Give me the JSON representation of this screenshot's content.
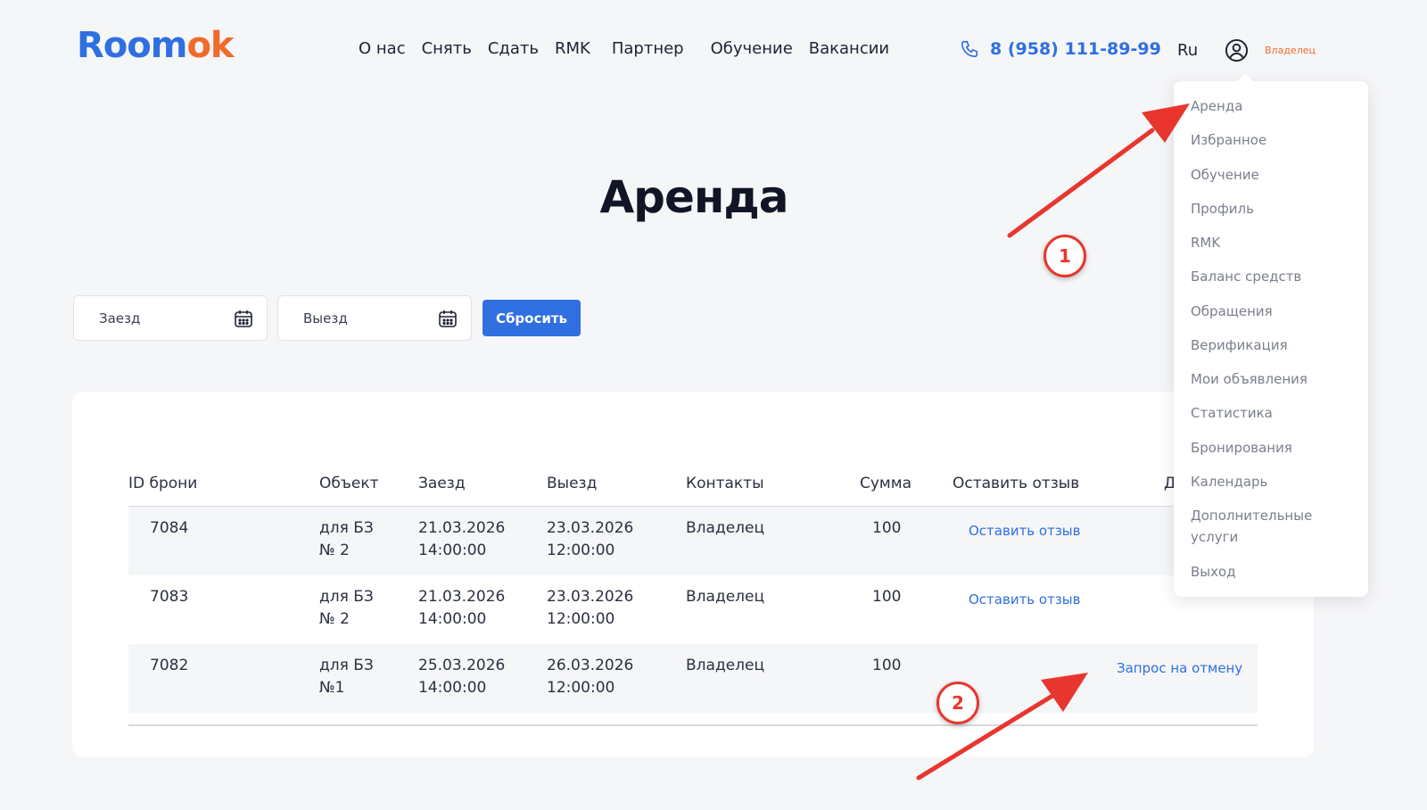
{
  "brand": {
    "logo_part1": "Room",
    "logo_part2": "ok"
  },
  "nav": [
    "О нас",
    "Снять",
    "Сдать",
    "RMK",
    "Партнер",
    "Обучение",
    "Вакансии"
  ],
  "header": {
    "phone": "8 (958) 111-89-99",
    "lang": "Ru",
    "role": "Владелец"
  },
  "page_title": "Аренда",
  "filters": {
    "checkin_placeholder": "Заезд",
    "checkout_placeholder": "Выезд",
    "reset_label": "Сбросить"
  },
  "table": {
    "headers": [
      "ID брони",
      "Объект",
      "Заезд",
      "Выезд",
      "Контакты",
      "Сумма",
      "Оставить отзыв",
      "Д"
    ],
    "rows": [
      {
        "id": "7084",
        "object": "для БЗ № 2",
        "checkin": "21.03.2026 14:00:00",
        "checkout": "23.03.2026 12:00:00",
        "contacts": "Владелец",
        "sum": "100",
        "review": "Оставить отзыв",
        "action": ""
      },
      {
        "id": "7083",
        "object": "для БЗ № 2",
        "checkin": "21.03.2026 14:00:00",
        "checkout": "23.03.2026 12:00:00",
        "contacts": "Владелец",
        "sum": "100",
        "review": "Оставить отзыв",
        "action": ""
      },
      {
        "id": "7082",
        "object": "для БЗ №1",
        "checkin": "25.03.2026 14:00:00",
        "checkout": "26.03.2026 12:00:00",
        "contacts": "Владелец",
        "sum": "100",
        "review": "",
        "action": "Запрос на отмену"
      }
    ]
  },
  "dropdown": [
    "Аренда",
    "Избранное",
    "Обучение",
    "Профиль",
    "RMK",
    "Баланс средств",
    "Обращения",
    "Верификация",
    "Мои объявления",
    "Статистика",
    "Бронирования",
    "Календарь",
    "Дополнительные услуги",
    "Выход"
  ],
  "annotations": {
    "badge1": "1",
    "badge2": "2"
  },
  "colors": {
    "accent": "#2f6fe0",
    "brand_orange": "#f26a2b",
    "annotation_red": "#e8362e"
  }
}
